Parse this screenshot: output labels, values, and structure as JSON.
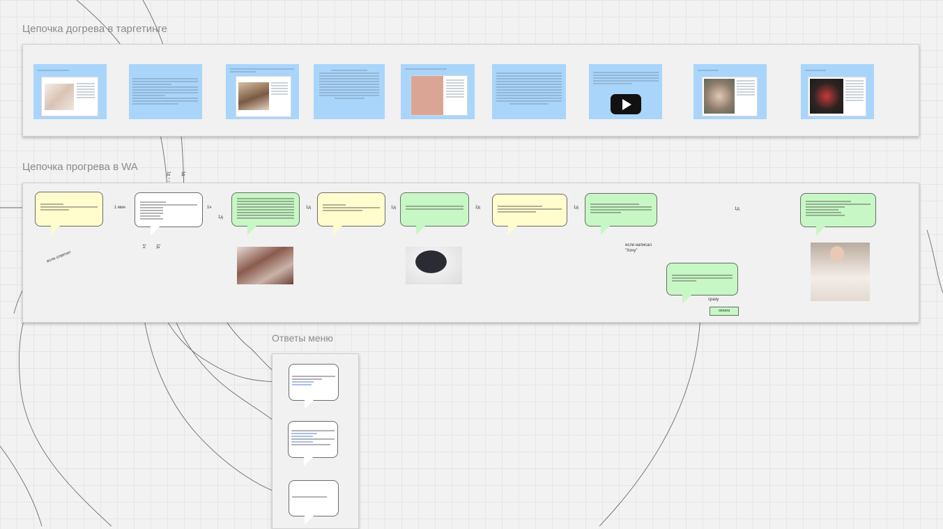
{
  "sections": {
    "targeting_title": "Цепочка догрева в таргетинге",
    "wa_title": "Цепочка прогрева в WA",
    "menu_title": "Ответы меню"
  },
  "edge_labels": {
    "e1": "1 мин",
    "e2": "1ч",
    "e3": "1д",
    "e4": "1д",
    "e5": "1д",
    "e6": "2д",
    "e7": "1д",
    "e8": "1д",
    "e9": "если ответил",
    "e10": "если написал\n\"Хочу\"",
    "e11": "сразу",
    "e12": "1д",
    "e13": "1д",
    "e14": "1ч",
    "e15": "1д"
  },
  "tag": "оплата",
  "colors": {
    "card_blue": "#a9d5fb",
    "bubble_yellow": "#fffccd",
    "bubble_green": "#c6f7c4",
    "frame": "#f1f1f1"
  }
}
